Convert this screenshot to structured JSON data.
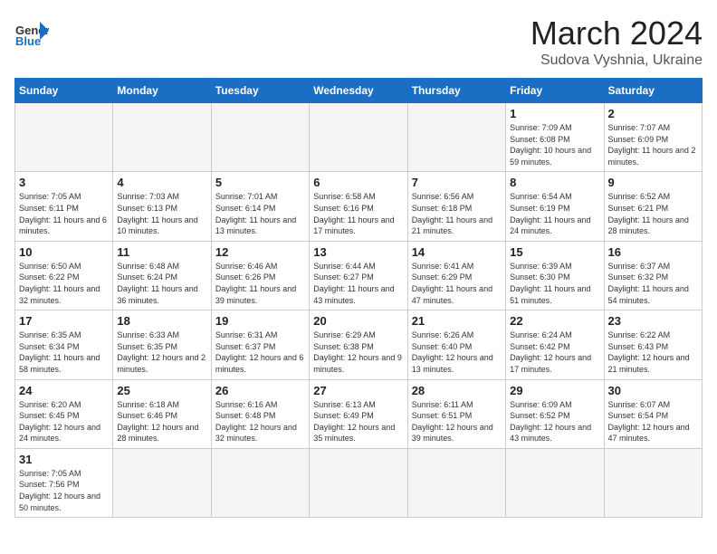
{
  "header": {
    "logo_general": "General",
    "logo_blue": "Blue",
    "month": "March 2024",
    "location": "Sudova Vyshnia, Ukraine"
  },
  "weekdays": [
    "Sunday",
    "Monday",
    "Tuesday",
    "Wednesday",
    "Thursday",
    "Friday",
    "Saturday"
  ],
  "weeks": [
    [
      {
        "day": "",
        "info": ""
      },
      {
        "day": "",
        "info": ""
      },
      {
        "day": "",
        "info": ""
      },
      {
        "day": "",
        "info": ""
      },
      {
        "day": "",
        "info": ""
      },
      {
        "day": "1",
        "info": "Sunrise: 7:09 AM\nSunset: 6:08 PM\nDaylight: 10 hours and 59 minutes."
      },
      {
        "day": "2",
        "info": "Sunrise: 7:07 AM\nSunset: 6:09 PM\nDaylight: 11 hours and 2 minutes."
      }
    ],
    [
      {
        "day": "3",
        "info": "Sunrise: 7:05 AM\nSunset: 6:11 PM\nDaylight: 11 hours and 6 minutes."
      },
      {
        "day": "4",
        "info": "Sunrise: 7:03 AM\nSunset: 6:13 PM\nDaylight: 11 hours and 10 minutes."
      },
      {
        "day": "5",
        "info": "Sunrise: 7:01 AM\nSunset: 6:14 PM\nDaylight: 11 hours and 13 minutes."
      },
      {
        "day": "6",
        "info": "Sunrise: 6:58 AM\nSunset: 6:16 PM\nDaylight: 11 hours and 17 minutes."
      },
      {
        "day": "7",
        "info": "Sunrise: 6:56 AM\nSunset: 6:18 PM\nDaylight: 11 hours and 21 minutes."
      },
      {
        "day": "8",
        "info": "Sunrise: 6:54 AM\nSunset: 6:19 PM\nDaylight: 11 hours and 24 minutes."
      },
      {
        "day": "9",
        "info": "Sunrise: 6:52 AM\nSunset: 6:21 PM\nDaylight: 11 hours and 28 minutes."
      }
    ],
    [
      {
        "day": "10",
        "info": "Sunrise: 6:50 AM\nSunset: 6:22 PM\nDaylight: 11 hours and 32 minutes."
      },
      {
        "day": "11",
        "info": "Sunrise: 6:48 AM\nSunset: 6:24 PM\nDaylight: 11 hours and 36 minutes."
      },
      {
        "day": "12",
        "info": "Sunrise: 6:46 AM\nSunset: 6:26 PM\nDaylight: 11 hours and 39 minutes."
      },
      {
        "day": "13",
        "info": "Sunrise: 6:44 AM\nSunset: 6:27 PM\nDaylight: 11 hours and 43 minutes."
      },
      {
        "day": "14",
        "info": "Sunrise: 6:41 AM\nSunset: 6:29 PM\nDaylight: 11 hours and 47 minutes."
      },
      {
        "day": "15",
        "info": "Sunrise: 6:39 AM\nSunset: 6:30 PM\nDaylight: 11 hours and 51 minutes."
      },
      {
        "day": "16",
        "info": "Sunrise: 6:37 AM\nSunset: 6:32 PM\nDaylight: 11 hours and 54 minutes."
      }
    ],
    [
      {
        "day": "17",
        "info": "Sunrise: 6:35 AM\nSunset: 6:34 PM\nDaylight: 11 hours and 58 minutes."
      },
      {
        "day": "18",
        "info": "Sunrise: 6:33 AM\nSunset: 6:35 PM\nDaylight: 12 hours and 2 minutes."
      },
      {
        "day": "19",
        "info": "Sunrise: 6:31 AM\nSunset: 6:37 PM\nDaylight: 12 hours and 6 minutes."
      },
      {
        "day": "20",
        "info": "Sunrise: 6:29 AM\nSunset: 6:38 PM\nDaylight: 12 hours and 9 minutes."
      },
      {
        "day": "21",
        "info": "Sunrise: 6:26 AM\nSunset: 6:40 PM\nDaylight: 12 hours and 13 minutes."
      },
      {
        "day": "22",
        "info": "Sunrise: 6:24 AM\nSunset: 6:42 PM\nDaylight: 12 hours and 17 minutes."
      },
      {
        "day": "23",
        "info": "Sunrise: 6:22 AM\nSunset: 6:43 PM\nDaylight: 12 hours and 21 minutes."
      }
    ],
    [
      {
        "day": "24",
        "info": "Sunrise: 6:20 AM\nSunset: 6:45 PM\nDaylight: 12 hours and 24 minutes."
      },
      {
        "day": "25",
        "info": "Sunrise: 6:18 AM\nSunset: 6:46 PM\nDaylight: 12 hours and 28 minutes."
      },
      {
        "day": "26",
        "info": "Sunrise: 6:16 AM\nSunset: 6:48 PM\nDaylight: 12 hours and 32 minutes."
      },
      {
        "day": "27",
        "info": "Sunrise: 6:13 AM\nSunset: 6:49 PM\nDaylight: 12 hours and 35 minutes."
      },
      {
        "day": "28",
        "info": "Sunrise: 6:11 AM\nSunset: 6:51 PM\nDaylight: 12 hours and 39 minutes."
      },
      {
        "day": "29",
        "info": "Sunrise: 6:09 AM\nSunset: 6:52 PM\nDaylight: 12 hours and 43 minutes."
      },
      {
        "day": "30",
        "info": "Sunrise: 6:07 AM\nSunset: 6:54 PM\nDaylight: 12 hours and 47 minutes."
      }
    ],
    [
      {
        "day": "31",
        "info": "Sunrise: 7:05 AM\nSunset: 7:56 PM\nDaylight: 12 hours and 50 minutes."
      },
      {
        "day": "",
        "info": ""
      },
      {
        "day": "",
        "info": ""
      },
      {
        "day": "",
        "info": ""
      },
      {
        "day": "",
        "info": ""
      },
      {
        "day": "",
        "info": ""
      },
      {
        "day": "",
        "info": ""
      }
    ]
  ]
}
